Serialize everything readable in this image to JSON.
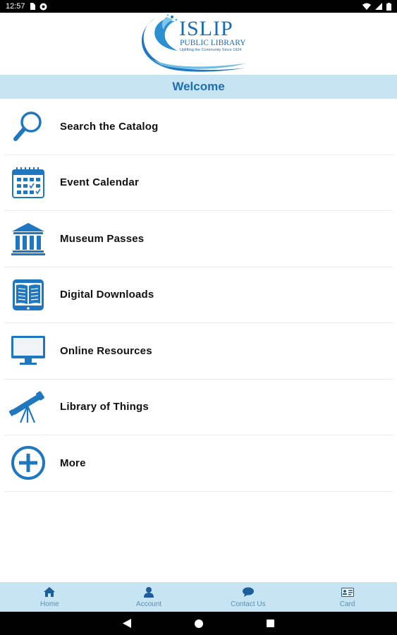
{
  "status_bar": {
    "time": "12:57"
  },
  "logo": {
    "title": "ISLIP",
    "subtitle": "PUBLIC LIBRARY",
    "tagline": "Uplifting the Community Since 1924"
  },
  "header": {
    "welcome": "Welcome"
  },
  "menu": {
    "items": [
      {
        "label": "Search the Catalog",
        "icon": "search-icon"
      },
      {
        "label": "Event Calendar",
        "icon": "calendar-icon"
      },
      {
        "label": "Museum Passes",
        "icon": "museum-icon"
      },
      {
        "label": "Digital Downloads",
        "icon": "ebook-tablet-icon"
      },
      {
        "label": "Online Resources",
        "icon": "monitor-icon"
      },
      {
        "label": "Library of Things",
        "icon": "telescope-icon"
      },
      {
        "label": "More",
        "icon": "plus-circle-icon"
      }
    ]
  },
  "tabs": [
    {
      "label": "Home",
      "icon": "home-icon"
    },
    {
      "label": "Account",
      "icon": "person-icon"
    },
    {
      "label": "Contact Us",
      "icon": "chat-bubble-icon"
    },
    {
      "label": "Card",
      "icon": "id-card-icon"
    }
  ],
  "colors": {
    "accent": "#1b6fb3",
    "icon_blue": "#1f77c0",
    "header_bg": "#c6e4f1",
    "tab_label": "#5f8fb3"
  }
}
